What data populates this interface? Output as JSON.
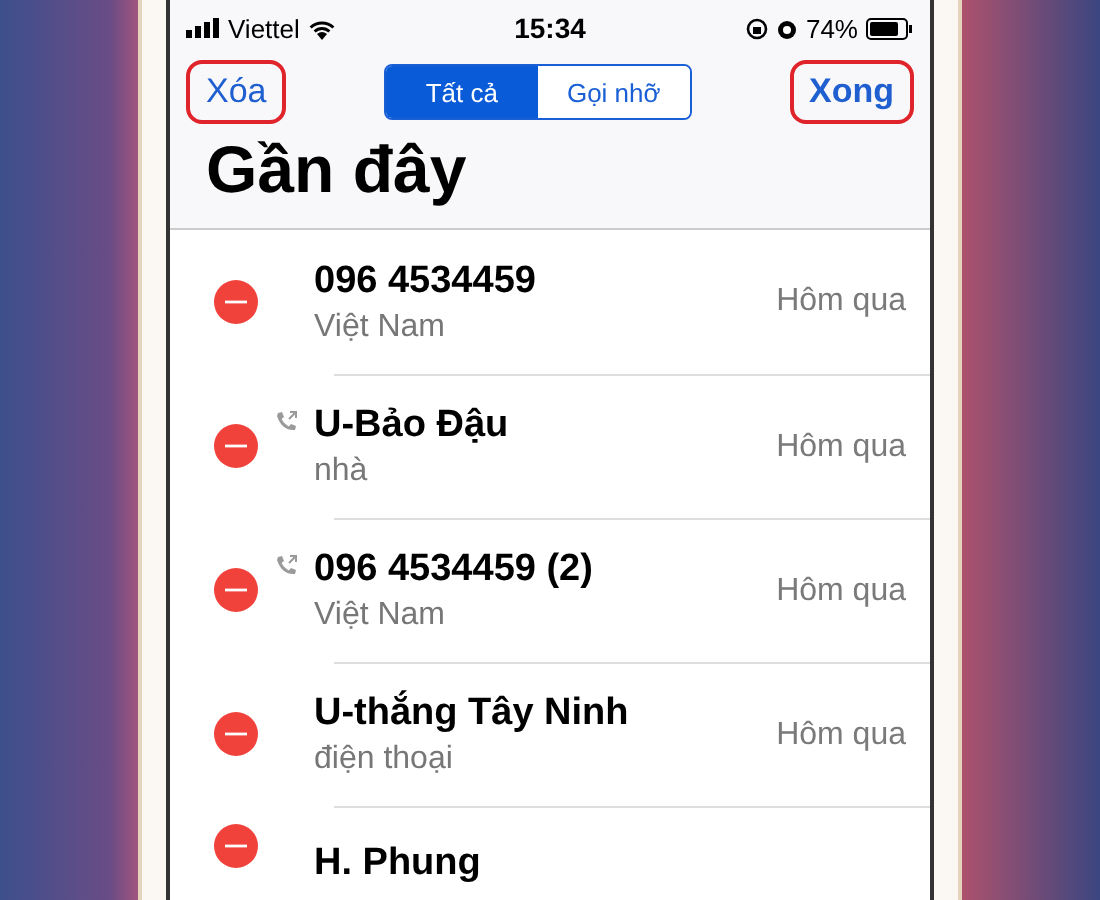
{
  "status_bar": {
    "carrier": "Viettel",
    "time": "15:34",
    "battery": "74%"
  },
  "nav": {
    "left_button": "Xóa",
    "right_button": "Xong",
    "segments": [
      {
        "label": "Tất cả",
        "selected": true
      },
      {
        "label": "Gọi nhỡ",
        "selected": false
      }
    ]
  },
  "title": "Gần đây",
  "calls": [
    {
      "name": "096 4534459",
      "detail": "Việt Nam",
      "time": "Hôm qua",
      "outgoing": false
    },
    {
      "name": "U-Bảo Đậu",
      "detail": "nhà",
      "time": "Hôm qua",
      "outgoing": true
    },
    {
      "name": "096 4534459 (2)",
      "detail": "Việt Nam",
      "time": "Hôm qua",
      "outgoing": true
    },
    {
      "name": "U-thắng Tây Ninh",
      "detail": "điện thoại",
      "time": "Hôm qua",
      "outgoing": false
    },
    {
      "name": "H. Phung",
      "outgoing": false
    }
  ]
}
